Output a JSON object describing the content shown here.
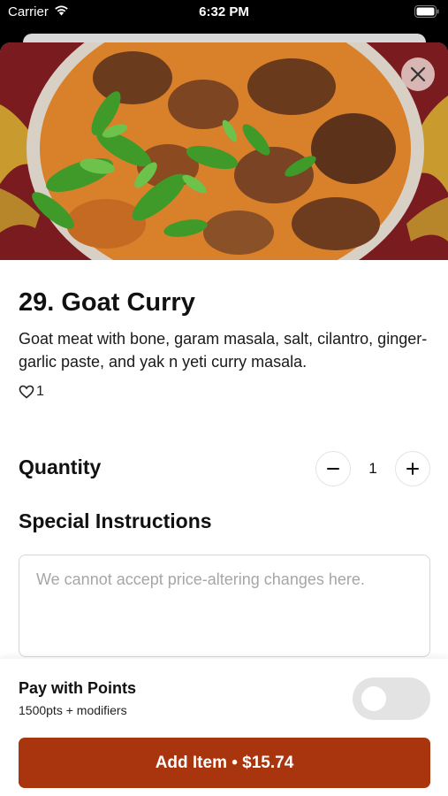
{
  "status_bar": {
    "carrier": "Carrier",
    "time": "6:32 PM",
    "icons": [
      "wifi-icon",
      "battery-icon"
    ]
  },
  "item": {
    "title": "29. Goat Curry",
    "description": "Goat meat with bone, garam masala, salt, cilantro, ginger-garlic paste, and yak n yeti curry masala.",
    "likes": "1",
    "hero_icon": "food-photo"
  },
  "quantity": {
    "label": "Quantity",
    "value": "1",
    "minus_symbol": "−",
    "plus_symbol": "+"
  },
  "special_instructions": {
    "label": "Special Instructions",
    "placeholder": "We cannot accept price-altering changes here.",
    "value": ""
  },
  "points": {
    "title": "Pay with Points",
    "subtitle": "1500pts + modifiers",
    "enabled": false
  },
  "add_button": {
    "label": "Add Item • $15.74"
  },
  "colors": {
    "accent": "#a8350d",
    "hero_background": "#7a1b1f",
    "toggle_off": "#e3e3e3"
  }
}
